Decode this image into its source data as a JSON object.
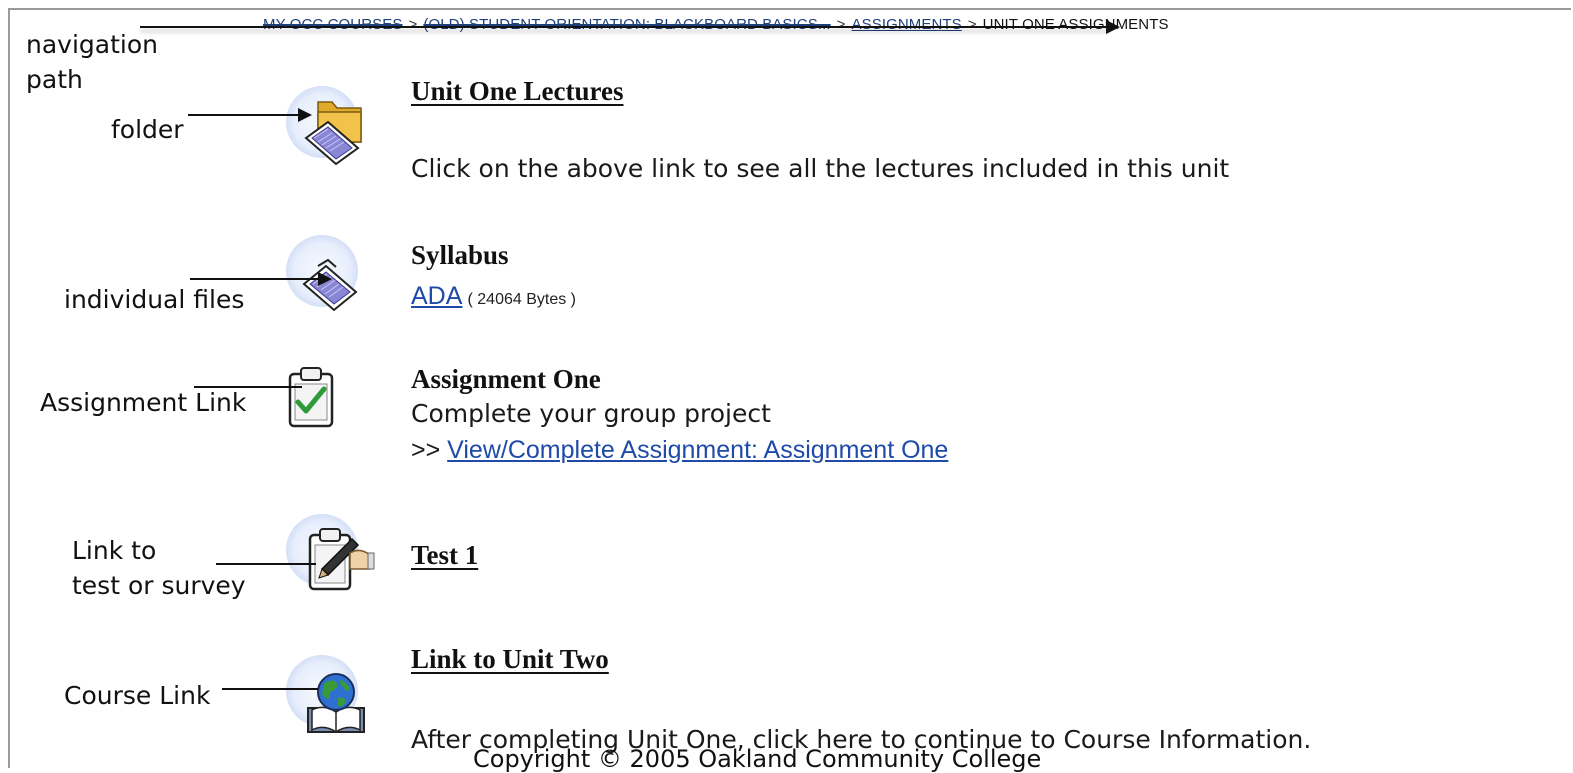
{
  "breadcrumb": {
    "item1": "MY OCC COURSES",
    "item2": "(OLD) STUDENT ORIENTATION: BLACKBOARD BASICS...",
    "item3": "ASSIGNMENTS",
    "current": "UNIT ONE ASSIGNMENTS",
    "separator": ">"
  },
  "annotations": {
    "navigation_line1": "navigation",
    "navigation_line2": "path",
    "folder": "folder",
    "individual_files": "individual files",
    "assignment_link": "Assignment Link",
    "test_line1": "Link to",
    "test_line2": "test or survey",
    "course_link": "Course Link"
  },
  "items": {
    "lectures": {
      "title": "Unit One Lectures",
      "description": "Click on the above link to see all the lectures included in this unit",
      "icon": "folder-icon"
    },
    "syllabus": {
      "title": "Syllabus",
      "file_link": "ADA",
      "file_size": "( 24064 Bytes )",
      "icon": "document-icon"
    },
    "assignment": {
      "title": "Assignment One",
      "description": "Complete your group project",
      "prefix": ">>",
      "link": "View/Complete Assignment: Assignment One",
      "icon": "clipboard-check-icon"
    },
    "test": {
      "title": "Test 1",
      "icon": "clipboard-pencil-icon"
    },
    "unit_two": {
      "title": "Link to Unit Two",
      "description": "After completing Unit One, click here to continue to Course Information.",
      "icon": "globe-book-icon"
    }
  },
  "footer": {
    "copyright": "Copyright © 2005 Oakland Community College"
  },
  "colors": {
    "link": "#1f4aa8",
    "breadcrumb_link": "#1f3f7a",
    "frame": "#9a9a9a"
  }
}
